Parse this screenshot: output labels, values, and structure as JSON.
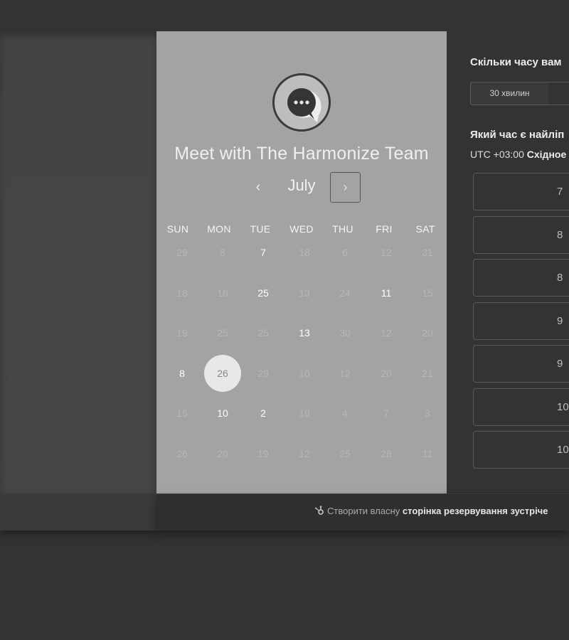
{
  "colors": {
    "card_left": "#a3a3a3",
    "card_right": "#333333",
    "selected_day": "#e8e8e8"
  },
  "meeting": {
    "title": "Meet with The Harmonize Team",
    "avatar_icon": "chat-bubble-icon"
  },
  "calendar": {
    "month": "July",
    "prev_icon": "‹",
    "next_icon": "›",
    "weekdays": [
      "SUN",
      "MON",
      "TUE",
      "WED",
      "THU",
      "FRI",
      "SAT"
    ],
    "weeks": [
      [
        {
          "d": "29",
          "s": "dim"
        },
        {
          "d": "8",
          "s": "dim"
        },
        {
          "d": "7",
          "s": "av"
        },
        {
          "d": "18",
          "s": "dim"
        },
        {
          "d": "6",
          "s": "dim"
        },
        {
          "d": "12",
          "s": "dim"
        },
        {
          "d": "31",
          "s": "dim"
        }
      ],
      [
        {
          "d": "18",
          "s": "dim"
        },
        {
          "d": "18",
          "s": "dim"
        },
        {
          "d": "25",
          "s": "av"
        },
        {
          "d": "13",
          "s": "dim"
        },
        {
          "d": "24",
          "s": "dim"
        },
        {
          "d": "11",
          "s": "av"
        },
        {
          "d": "15",
          "s": "dim"
        }
      ],
      [
        {
          "d": "19",
          "s": "dim"
        },
        {
          "d": "25",
          "s": "dim"
        },
        {
          "d": "25",
          "s": "dim"
        },
        {
          "d": "13",
          "s": "av"
        },
        {
          "d": "30",
          "s": "dim"
        },
        {
          "d": "12",
          "s": "dim"
        },
        {
          "d": "20",
          "s": "dim"
        }
      ],
      [
        {
          "d": "8",
          "s": "av"
        },
        {
          "d": "26",
          "s": "sel"
        },
        {
          "d": "29",
          "s": "dim"
        },
        {
          "d": "10",
          "s": "dim"
        },
        {
          "d": "12",
          "s": "dim"
        },
        {
          "d": "20",
          "s": "dim"
        },
        {
          "d": "21",
          "s": "dim"
        }
      ],
      [
        {
          "d": "15",
          "s": "dim"
        },
        {
          "d": "10",
          "s": "av"
        },
        {
          "d": "2",
          "s": "av"
        },
        {
          "d": "19",
          "s": "dim"
        },
        {
          "d": "4",
          "s": "dim"
        },
        {
          "d": "7",
          "s": "dim"
        },
        {
          "d": "3",
          "s": "dim"
        }
      ],
      [
        {
          "d": "26",
          "s": "dim"
        },
        {
          "d": "20",
          "s": "dim"
        },
        {
          "d": "19",
          "s": "dim"
        },
        {
          "d": "12",
          "s": "dim"
        },
        {
          "d": "25",
          "s": "dim"
        },
        {
          "d": "28",
          "s": "dim"
        },
        {
          "d": "11",
          "s": "dim"
        }
      ]
    ]
  },
  "booking": {
    "duration_question": "Скільки часу вам",
    "duration_option": "30 хвилин",
    "time_question": "Який час є найліп",
    "timezone_offset": "UTC +03:00",
    "timezone_name": "Східное",
    "slots": [
      "7",
      "8",
      "8",
      "9",
      "9",
      "10",
      "10"
    ]
  },
  "footer": {
    "prefix": "Створити власну",
    "link": "сторінка резервування зустріче",
    "icon": "hubspot-sprocket-icon"
  }
}
